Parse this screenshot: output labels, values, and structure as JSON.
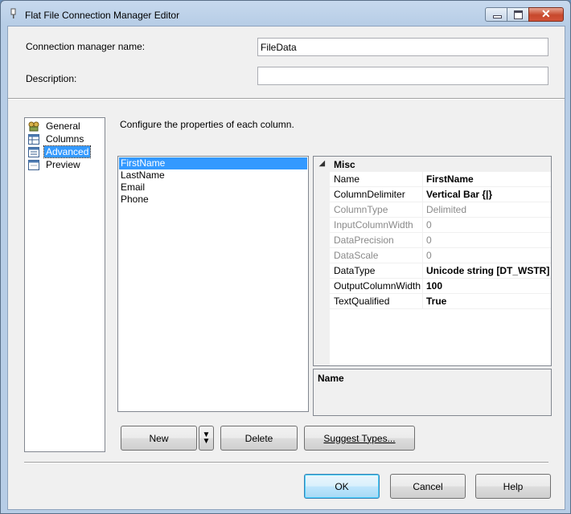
{
  "window": {
    "title": "Flat File Connection Manager Editor"
  },
  "form": {
    "name_label": "Connection manager name:",
    "name_value": "FileData",
    "description_label": "Description:",
    "description_value": ""
  },
  "nav": {
    "items": [
      {
        "label": "General",
        "icon": "general-icon"
      },
      {
        "label": "Columns",
        "icon": "columns-icon"
      },
      {
        "label": "Advanced",
        "icon": "advanced-icon",
        "selected": true
      },
      {
        "label": "Preview",
        "icon": "preview-icon"
      }
    ]
  },
  "main": {
    "instruction": "Configure the properties of each column.",
    "columns": [
      "FirstName",
      "LastName",
      "Email",
      "Phone"
    ],
    "selected_column": "FirstName"
  },
  "properties": {
    "category": "Misc",
    "rows": [
      {
        "name": "Name",
        "value": "FirstName",
        "bold": true
      },
      {
        "name": "ColumnDelimiter",
        "value": "Vertical Bar {|}",
        "bold": true
      },
      {
        "name": "ColumnType",
        "value": "Delimited",
        "disabled": true
      },
      {
        "name": "InputColumnWidth",
        "value": "0",
        "disabled": true
      },
      {
        "name": "DataPrecision",
        "value": "0",
        "disabled": true
      },
      {
        "name": "DataScale",
        "value": "0",
        "disabled": true
      },
      {
        "name": "DataType",
        "value": "Unicode string [DT_WSTR]",
        "bold": true
      },
      {
        "name": "OutputColumnWidth",
        "value": "100",
        "bold": true
      },
      {
        "name": "TextQualified",
        "value": "True",
        "bold": true
      }
    ],
    "description_title": "Name"
  },
  "buttons": {
    "new": "New",
    "delete": "Delete",
    "suggest_types": "Suggest Types...",
    "ok": "OK",
    "cancel": "Cancel",
    "help": "Help"
  },
  "colors": {
    "selection": "#3399ff",
    "disabled_text": "#8a8a8a"
  }
}
